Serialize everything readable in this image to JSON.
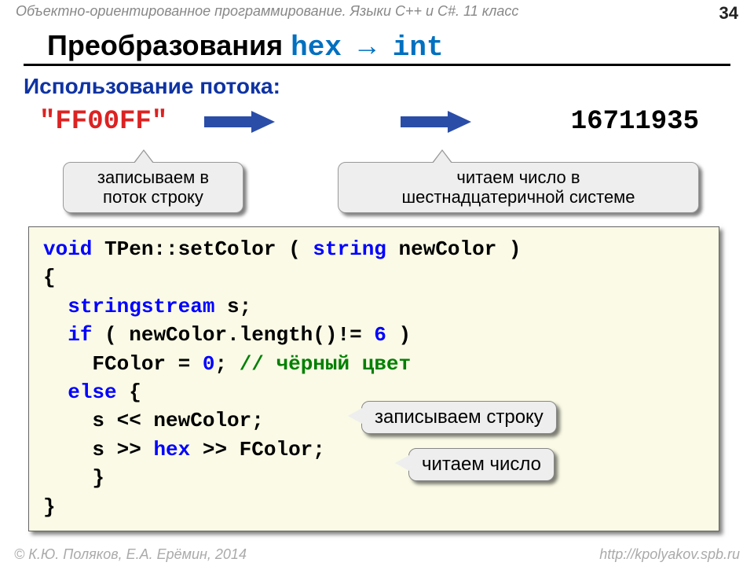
{
  "header": "Объектно-ориентированное программирование. Языки C++ и C#. 11 класс",
  "page_num": "34",
  "title_pre": "Преобразования ",
  "title_hex": "hex",
  "title_arrow": " → ",
  "title_int": "int",
  "subtitle": "Использование потока:",
  "hex_str": "\"FF00FF\"",
  "int_val": "16711935",
  "callout1_l1": "записываем в",
  "callout1_l2": "поток строку",
  "callout2_l1": "читаем число в",
  "callout2_l2": "шестнадцатеричной системе",
  "code": {
    "l1a": "void",
    "l1b": " TPen::setColor ( ",
    "l1c": "string",
    "l1d": " newColor )",
    "l2": "{",
    "l3a": "stringstream",
    "l3b": " s;",
    "l4a": "if",
    "l4b": " ( newColor.length()!= ",
    "l4c": "6",
    "l4d": " )",
    "l5a": "FColor = ",
    "l5b": "0",
    "l5c": ";  ",
    "l5d": "// чёрный цвет",
    "l6a": "else",
    "l6b": " {",
    "l7": "s << newColor;",
    "l8a": "s >> ",
    "l8b": "hex",
    "l8c": " >> FColor;",
    "l9": "}",
    "l10": "}"
  },
  "callout3": "записываем строку",
  "callout4": "читаем число",
  "footer_left": "© К.Ю. Поляков, Е.А. Ерёмин, 2014",
  "footer_right": "http://kpolyakov.spb.ru"
}
